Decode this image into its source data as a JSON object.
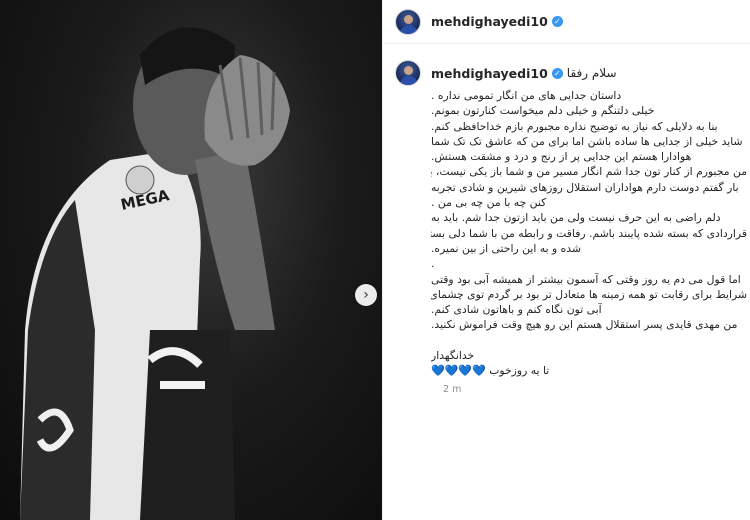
{
  "post": {
    "username": "mehdighayedi10",
    "verified": true,
    "avatar_icon": "avatar",
    "greeting": "سلام رفقا",
    "caption_lines": [
      "داستان جدایی های من انگار تمومی نداره .",
      "خیلی دلتنگم و خیلی دلم میخواست کنارتون بمونم.",
      "بنا به دلایلی که نیاز به توضیح نداره مجبورم بازم خداحافظی کنم.",
      "شاید خیلی از جدایی ها ساده باشن اما برای من که عاشق تک تک شما",
      "هوادارا هستم این جدایی پر از رنج و درد و مشقت هستش.",
      "من مجبورم از کنار تون جدا شم انگار مسیر من و شما باز یکی نیست، یه",
      "بار گفتم دوست دارم هواداران استقلال روزهای شیرین و شادی تجربه",
      "کنن چه با من چه بی من .",
      "دلم راضی به این حرف نیست ولی من باید ازتون جدا شم. باید به",
      "قراردادی که بسته شده پایبند باشم. رفاقت و رابطه من با شما دلی بسته",
      "شده و به این راحتی از بین نمیره."
    ],
    "dot_line": ".",
    "caption_lines_2": [
      "اما قول می دم یه روز وقتی که آسمون بیشتر از همیشه آبی بود وقتی",
      "شرایط برای رقابت تو همه زمینه ها متعادل تر بود بر گردم توی چشمای",
      "آبی تون نگاه کنم و باهاتون شادی کنم.",
      "من مهدی قایدی پسر استقلال هستم این رو هیچ وقت فراموش نکنید."
    ],
    "signoff": "خدانگهدار",
    "signoff_2": "تا یه روزخوب",
    "hearts": "💙💙💙💙",
    "timestamp": "2 m"
  },
  "photo": {
    "jersey_text": "MEGA"
  },
  "colors": {
    "verified": "#3897f0",
    "heart": "#2c6fd6",
    "timestamp": "#8e8e8e"
  },
  "carousel": {
    "next_icon": "›"
  }
}
